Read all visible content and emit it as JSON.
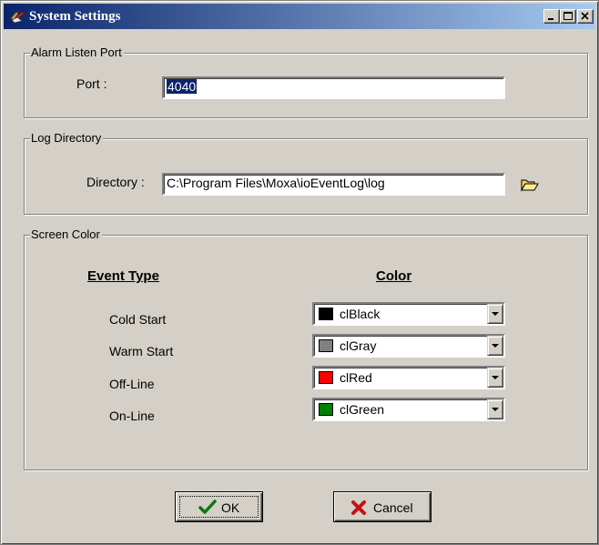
{
  "window": {
    "title": "System Settings",
    "controls": [
      "minimize-icon",
      "maximize-icon",
      "close-icon"
    ]
  },
  "alarm": {
    "legend": "Alarm Listen Port",
    "port_label": "Port :",
    "port_value": "4040"
  },
  "log": {
    "legend": "Log Directory",
    "dir_label": "Directory :",
    "dir_value": "C:\\Program Files\\Moxa\\ioEventLog\\log",
    "browse_icon": "open-folder-icon"
  },
  "screen_color": {
    "legend": "Screen Color",
    "col_event_type": "Event Type",
    "col_color": "Color",
    "rows": [
      {
        "event": "Cold Start",
        "color_name": "clBlack",
        "swatch": "#000000"
      },
      {
        "event": "Warm Start",
        "color_name": "clGray",
        "swatch": "#808080"
      },
      {
        "event": "Off-Line",
        "color_name": "clRed",
        "swatch": "#ff0000"
      },
      {
        "event": "On-Line",
        "color_name": "clGreen",
        "swatch": "#008000"
      }
    ]
  },
  "buttons": {
    "ok_label": "OK",
    "ok_icon": "checkmark-icon",
    "cancel_label": "Cancel",
    "cancel_icon": "x-mark-icon"
  },
  "colors": {
    "titlebar_start": "#0a246a",
    "titlebar_end": "#a6caf0",
    "face": "#d4d0c8",
    "selection": "#0a246a"
  }
}
